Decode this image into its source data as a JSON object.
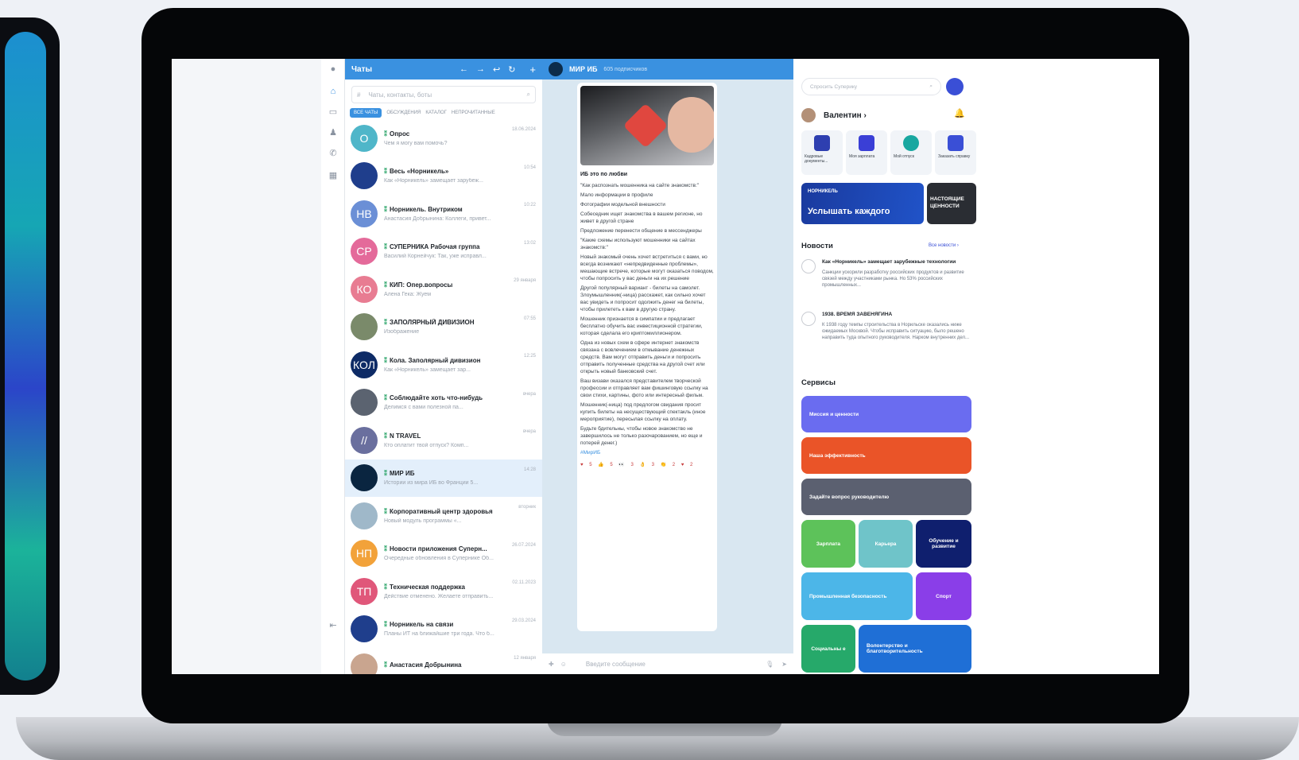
{
  "colors": {
    "accent": "#3a91e0",
    "brand_dark": "#1a3a9e"
  },
  "chats": {
    "title": "Чаты",
    "search_placeholder": "Чаты, контакты, боты",
    "tabs": [
      "ВСЕ ЧАТЫ",
      "ОБСУЖДЕНИЯ",
      "КАТАЛОГ",
      "НЕПРОЧИТАННЫЕ"
    ],
    "list": [
      {
        "initials": "О",
        "color": "#4fb6c9",
        "name": "Опрос",
        "preview": "Чем я могу вам помочь?",
        "time": "18.06.2024"
      },
      {
        "initials": "",
        "color": "#1f3e8c",
        "name": "Весь «Норникель»",
        "preview": "Как «Норникель» замещает зарубеж...",
        "time": "10:54"
      },
      {
        "initials": "НВ",
        "color": "#6b8fd6",
        "name": "Норникель. Внутриком",
        "preview": "Анастасия Добрынина: Коллеги, привет...",
        "time": "10:22"
      },
      {
        "initials": "СР",
        "color": "#e46a9a",
        "name": "СУПЕРНИКА Рабочая группа",
        "preview": "Василий Корнейчук: Так, уже исправл...",
        "time": "13:02"
      },
      {
        "initials": "КО",
        "color": "#e87c92",
        "name": "КИП: Опер.вопросы",
        "preview": "Алена Гека: Жуем",
        "time": "29 января"
      },
      {
        "initials": "",
        "color": "#7a8a6a",
        "name": "ЗАПОЛЯРНЫЙ ДИВИЗИОН",
        "preview": "Изображение",
        "time": "07:55"
      },
      {
        "initials": "КОЛ",
        "color": "#0e2b66",
        "name": "Кола. Заполярный дивизион",
        "preview": "Как «Норникель» замещает зар...",
        "time": "12:25"
      },
      {
        "initials": "",
        "color": "#5b6370",
        "name": "Соблюдайте хоть что-нибудь",
        "preview": "Делимся с вами полезной па...",
        "time": "вчера"
      },
      {
        "initials": "//",
        "color": "#6a6f9e",
        "name": "N TRAVEL",
        "preview": "Кто оплатит твой отпуск? Комп...",
        "time": "вчера"
      },
      {
        "initials": "",
        "color": "#0a2540",
        "name": "МИР ИБ",
        "preview": "Истории из мира ИБ во Франции 5...",
        "time": "14:28"
      },
      {
        "initials": "",
        "color": "#9fb8c9",
        "name": "Корпоративный центр здоровья",
        "preview": "Новый модуль программы «...",
        "time": "вторник"
      },
      {
        "initials": "НП",
        "color": "#f2a23a",
        "name": "Новости приложения Суперн...",
        "preview": "Очередные обновления в Супернике Об...",
        "time": "26.07.2024"
      },
      {
        "initials": "ТП",
        "color": "#e0577a",
        "name": "Техническая поддержка",
        "preview": "Действие отменено. Желаете отправить...",
        "time": "02.11.2023"
      },
      {
        "initials": "",
        "color": "#1f3e8c",
        "name": "Норникель на связи",
        "preview": "Планы ИТ на ближайшие три года. Что б...",
        "time": "29.03.2024"
      },
      {
        "initials": "",
        "color": "#c9a58f",
        "name": "Анастасия Добрынина",
        "preview": "",
        "time": "12 января"
      }
    ]
  },
  "conversation": {
    "title": "МИР ИБ",
    "subscribers": "605 подписчиков",
    "message_title": "ИБ это по любви",
    "lines": [
      "\"Как распознать мошенника на сайте знакомств:\"",
      "Мало информации в профиле",
      "Фотографии модельной внешности",
      "Собеседник ищет знакомства в вашем регионе, но живет в другой стране",
      "Предложение перенести общение в мессенджеры",
      "\"Какие схемы используют мошенники на сайтах знакомств:\"",
      "Новый знакомый очень хочет встретиться с вами, но всегда возникают «непредвиденные проблемы», мешающие встрече, которые могут оказаться поводом, чтобы попросить у вас деньги на их решение",
      "Другой популярный вариант - билеты на самолет. Злоумышленник(-ница) расскажет, как сильно хочет вас увидеть и попросит одолжить денег на билеты, чтобы прилететь к вам в другую страну.",
      "Мошенник признается в симпатии и предлагает бесплатно обучить вас инвестиционной стратегии, которая сделала его криптомиллионером.",
      "Одна из новых схем в сфере интернет знакомств связана с вовлечением в отмывание денежных средств. Вам могут отправить деньги и попросить отправить полученные средства на другой счет или открыть новый банковский счет.",
      "Ваш визави оказался представителем творческой профессии и отправляет вам фишинговую ссылку на свои стихи, картины, фото или интересный фильм.",
      "Мошенник(-ница) под предлогом свидания просит купить билеты на несуществующий спектакль (иное мероприятие), пересылая ссылку на оплату.",
      "Будьте бдительны, чтобы новое знакомство не завершилось не только разочарованием, но еще и потерей денег.)"
    ],
    "hashtag": "#МирИБ",
    "reactions": "♥ 5 👍 5 👀 3 👌 3 👏 2 ♥ 2",
    "compose_placeholder": "Введите сообщение"
  },
  "right": {
    "search_placeholder": "Спросить Суперику",
    "user": "Валентин ›",
    "tiles": [
      {
        "label": "Кадровые документы...",
        "color": "#2e3fb0"
      },
      {
        "label": "Моя зарплата",
        "color": "#3a3fd6"
      },
      {
        "label": "Мой отпуск",
        "color": "#18a7a0"
      },
      {
        "label": "Заказать справку",
        "color": "#3a4fd6"
      }
    ],
    "banner_brand": "НОРНИКЕЛЬ",
    "banner_text": "Услышать каждого",
    "banner2_text": "НАСТОЯЩИЕ ЦЕННОСТИ",
    "news_title": "Новости",
    "news_all": "Все новости ›",
    "news": [
      {
        "title": "Как «Норникель» замещает зарубежные технологии",
        "body": "Санкции ускорили разработку российских продуктов и развитие связей между участниками рынка. Но 53% российских промышленных..."
      },
      {
        "title": "1938. ВРЕМЯ ЗАВЕНЯГИНА",
        "body": "К 1938 году темпы строительства в Норильске оказались ниже ожидаемых Москвой. Чтобы исправить ситуацию, было решено направить туда опытного руководителя. Нарком внутренних дел..."
      }
    ],
    "services_title": "Сервисы",
    "services": {
      "mission": "Миссия и ценности",
      "efficiency": "Наша эффективность",
      "ask": "Задайте вопрос руководителю",
      "salary": "Зарплата",
      "career": "Карьера",
      "training": "Обучение и развитие",
      "safety": "Промышленная безопасность",
      "sport": "Спорт",
      "social": "Социальны е",
      "volunteer": "Волонтерство и благотворительность"
    }
  }
}
